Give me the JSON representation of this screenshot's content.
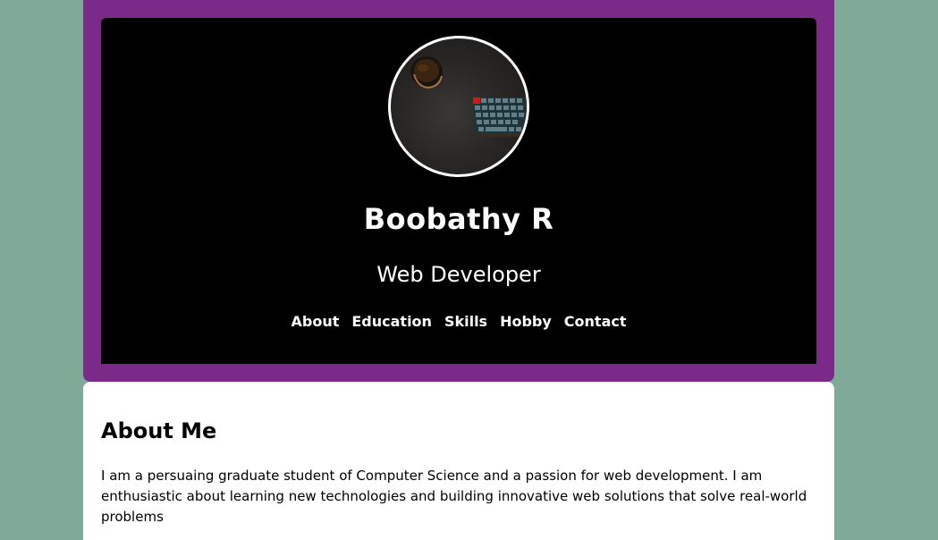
{
  "header": {
    "name": "Boobathy R",
    "role": "Web Developer",
    "avatar_icon": "profile-photo-desk-keyboard"
  },
  "nav": {
    "items": [
      {
        "label": "About"
      },
      {
        "label": "Education"
      },
      {
        "label": "Skills"
      },
      {
        "label": "Hobby"
      },
      {
        "label": "Contact"
      }
    ]
  },
  "about": {
    "title": "About Me",
    "text": "I am a persuaing graduate student of Computer Science and a passion for web development. I am enthusiastic about learning new technologies and building innovative web solutions that solve real-world problems"
  },
  "colors": {
    "page_background": "#7faa98",
    "header_frame": "#7b2a8a",
    "header_inner": "#000000",
    "text_light": "#ffffff",
    "card_background": "#ffffff"
  }
}
